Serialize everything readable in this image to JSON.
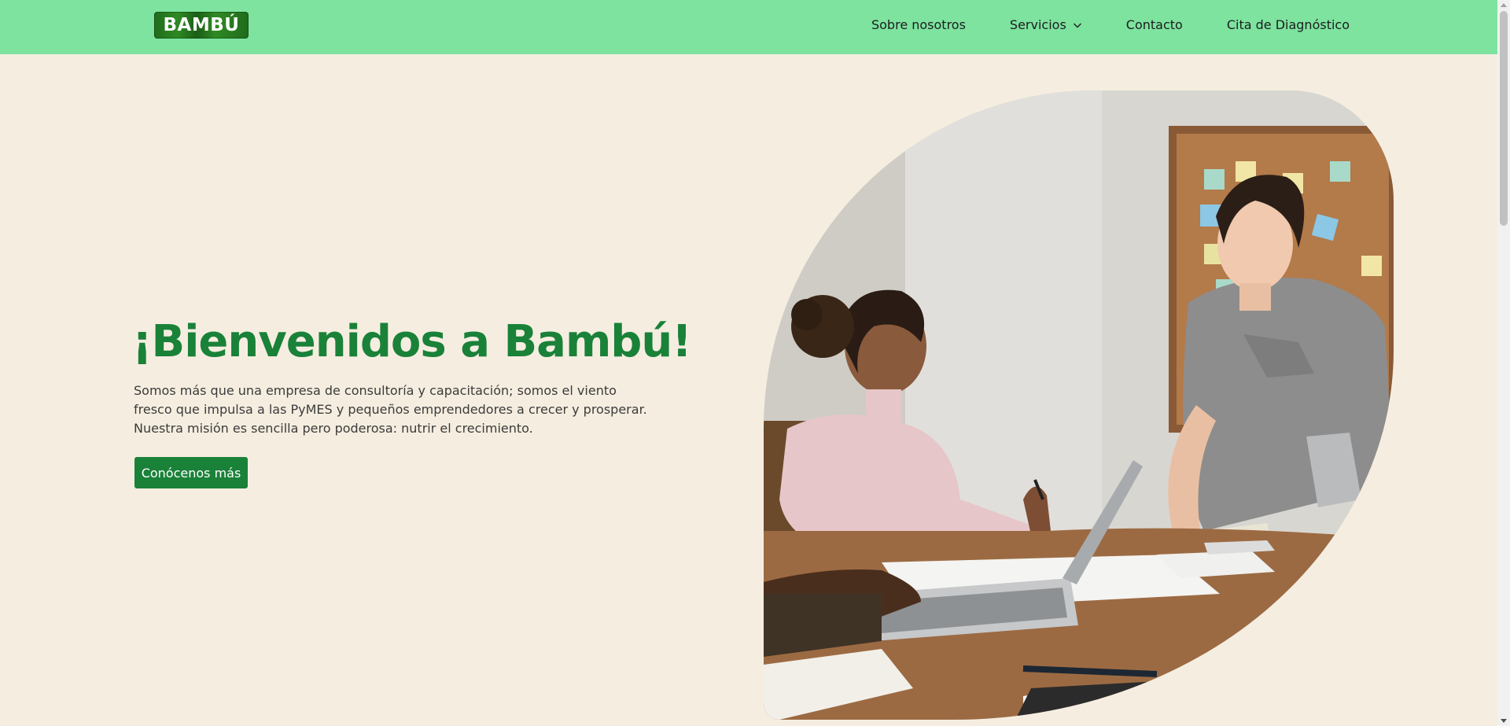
{
  "brand": {
    "logo_text": "BAMBÚ",
    "primary_color": "#1a8139",
    "nav_color": "#7de39f",
    "background": "#f5eee0"
  },
  "nav": {
    "items": [
      {
        "label": "Sobre nosotros"
      },
      {
        "label": "Servicios",
        "has_dropdown": true
      },
      {
        "label": "Contacto"
      },
      {
        "label": "Cita de Diagnóstico"
      }
    ]
  },
  "hero": {
    "title": "¡Bienvenidos a Bambú!",
    "description": "Somos más que una empresa de consultoría y capacitación; somos el viento fresco que impulsa a las PyMES y pequeños emprendedores a crecer y prosperar. Nuestra misión es sencilla pero poderosa: nutrir el crecimiento.",
    "cta_label": "Conócenos más",
    "image_subject": "office-meeting-photo"
  }
}
